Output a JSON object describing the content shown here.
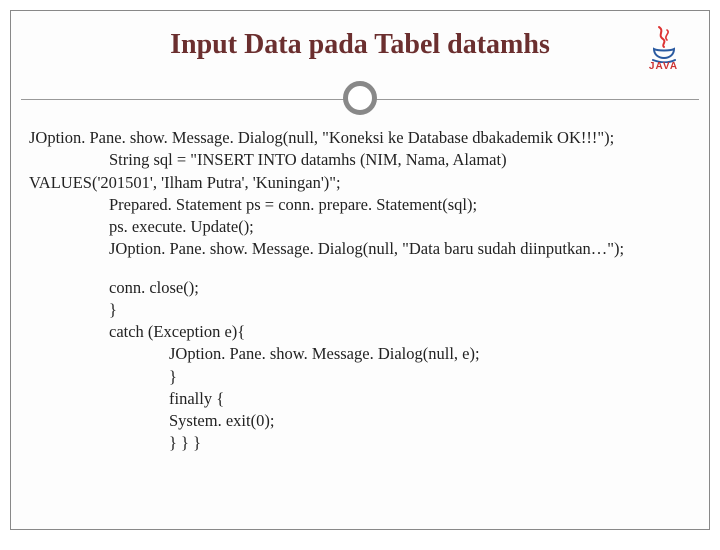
{
  "title": "Input Data pada Tabel datamhs",
  "logo_text": "JAVA",
  "code": {
    "l1": "JOption. Pane. show. Message. Dialog(null, \"Koneksi ke Database dbakademik OK!!!\");",
    "l2": "String sql = \"INSERT INTO datamhs (NIM, Nama, Alamat)",
    "l3": "VALUES('201501', 'Ilham Putra', 'Kuningan')\";",
    "l4": "Prepared. Statement ps = conn. prepare. Statement(sql);",
    "l5": "ps. execute. Update();",
    "l6": "JOption. Pane. show. Message. Dialog(null, \"Data baru sudah diinputkan…\");",
    "l7": "conn. close();",
    "l8": "}",
    "l9": "catch (Exception e){",
    "l10": "JOption. Pane. show. Message. Dialog(null, e);",
    "l11": "}",
    "l12": "finally {",
    "l13": "System. exit(0);",
    "l14": "} } }"
  }
}
